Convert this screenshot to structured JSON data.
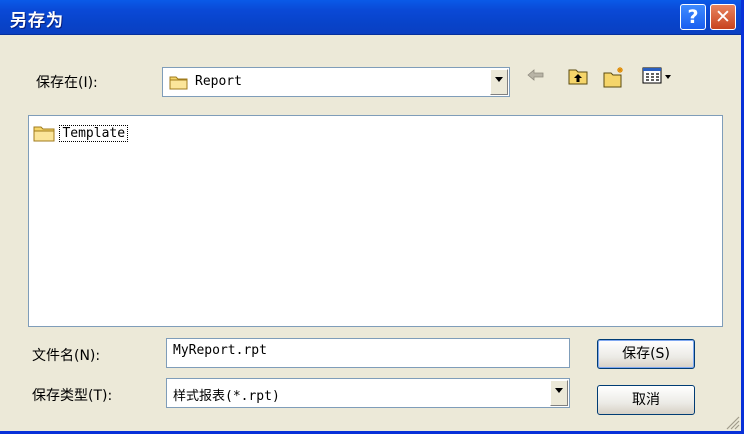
{
  "window": {
    "title": "另存为",
    "help_glyph": "?",
    "close_glyph": "✕"
  },
  "location": {
    "label": "保存在(I):",
    "value": "Report"
  },
  "toolbar": {
    "icons": [
      "back-arrow-icon",
      "up-folder-icon",
      "new-folder-icon",
      "view-menu-icon"
    ]
  },
  "files": [
    {
      "name": "Template"
    }
  ],
  "filename": {
    "label": "文件名(N):",
    "value": "MyReport.rpt"
  },
  "filetype": {
    "label": "保存类型(T):",
    "value": "样式报表(*.rpt)"
  },
  "buttons": {
    "save": "保存(S)",
    "cancel": "取消"
  },
  "colors": {
    "titlebar": "#0a49d6",
    "dialog_bg": "#ece9d8",
    "close_red": "#c8431e",
    "border": "#7f9db9"
  }
}
